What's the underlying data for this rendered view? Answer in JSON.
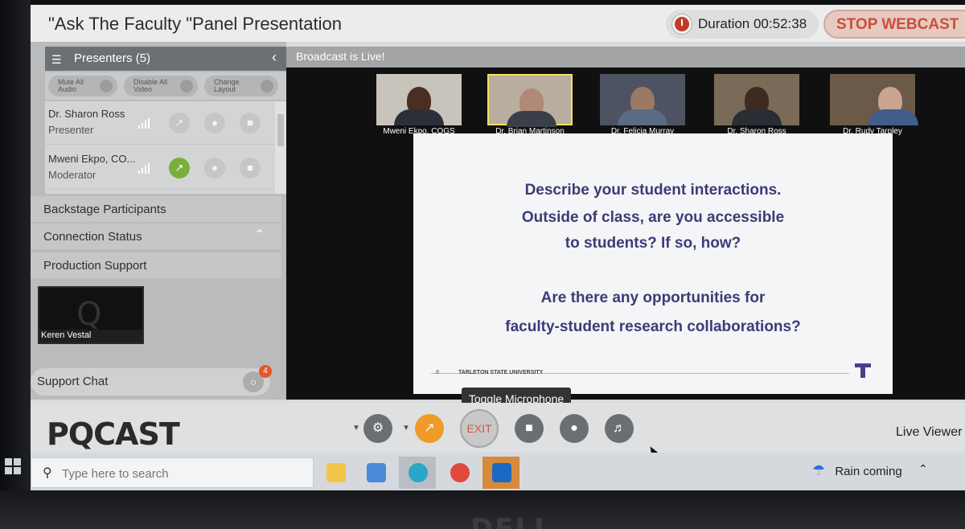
{
  "window": {
    "title": "\"Ask The Faculty \"Panel Presentation",
    "duration_label": "Duration 00:52:38",
    "stop_label": "STOP WEBCAST"
  },
  "presenters": {
    "header": "Presenters (5)",
    "controls": [
      "Mute All Audio",
      "Disable All Video",
      "Change Layout"
    ],
    "items": [
      {
        "name": "Dr. Sharon Ross",
        "role": "Presenter"
      },
      {
        "name": "Mweni Ekpo, CO...",
        "role": "Moderator"
      }
    ]
  },
  "sections": {
    "backstage": "Backstage Participants",
    "connection": "Connection Status",
    "production": "Production Support"
  },
  "preview_tile": {
    "letter": "Q",
    "name": "Keren Vestal"
  },
  "support_chat": {
    "label": "Support Chat",
    "badge": "4"
  },
  "broadcast": {
    "status": "Broadcast is Live!"
  },
  "videos": [
    {
      "name": "Mweni Ekpo, COGS"
    },
    {
      "name": "Dr. Brian Martinson"
    },
    {
      "name": "Dr. Felicia Murray"
    },
    {
      "name": "Dr. Sharon Ross"
    },
    {
      "name": "Dr. Rudy Tarpley"
    }
  ],
  "slide": {
    "lines": [
      "Describe your student interactions.",
      "Outside of class, are you accessible",
      "to students?  If so, how?",
      "Are there any opportunities for",
      "faculty-student research collaborations?"
    ],
    "page_number": "8",
    "footer": "TARLETON STATE UNIVERSITY"
  },
  "toolbar": {
    "brand": "PQCAST",
    "exit_label": "EXIT",
    "tooltip": "Toggle Microphone",
    "live_viewers": "Live Viewer"
  },
  "taskbar": {
    "search_placeholder": "Type here to search",
    "weather": "Rain coming"
  },
  "colors": {
    "stop_accent": "#c8503a",
    "share_orange": "#f09a2a",
    "active_green": "#7ab03a",
    "slide_text": "#3f3a78"
  }
}
